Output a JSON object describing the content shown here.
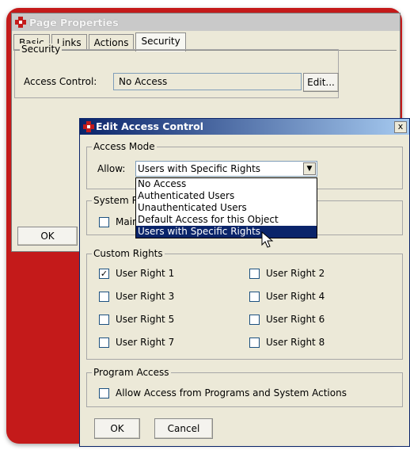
{
  "page_props": {
    "title": "Page Properties",
    "tabs": [
      "Basic",
      "Links",
      "Actions",
      "Security"
    ],
    "active_tab": "Security",
    "security_group": "Security",
    "access_control_label": "Access Control:",
    "access_control_value": "No Access",
    "edit_button": "Edit...",
    "ok_button": "OK"
  },
  "dialog": {
    "title": "Edit Access Control",
    "close": "x",
    "access_mode": {
      "legend": "Access Mode",
      "allow_label": "Allow:",
      "selected": "Users with Specific Rights",
      "options": [
        "No Access",
        "Authenticated Users",
        "Unauthenticated Users",
        "Default Access for this Object",
        "Users with Specific Rights"
      ],
      "highlighted_index": 4
    },
    "system_rights": {
      "legend": "System R",
      "item": "Main"
    },
    "custom_rights": {
      "legend": "Custom Rights",
      "items": [
        {
          "label": "User Right 1",
          "checked": true
        },
        {
          "label": "User Right 2",
          "checked": false
        },
        {
          "label": "User Right 3",
          "checked": false
        },
        {
          "label": "User Right 4",
          "checked": false
        },
        {
          "label": "User Right 5",
          "checked": false
        },
        {
          "label": "User Right 6",
          "checked": false
        },
        {
          "label": "User Right 7",
          "checked": false
        },
        {
          "label": "User Right 8",
          "checked": false
        }
      ]
    },
    "program_access": {
      "legend": "Program Access",
      "item": "Allow Access from Programs and System Actions",
      "checked": false
    },
    "ok_button": "OK",
    "cancel_button": "Cancel"
  },
  "colors": {
    "frame": "#c41a1a",
    "window_bg": "#ece9d8",
    "title_active": "#0a246a",
    "title_inactive": "#c9c9c9"
  }
}
